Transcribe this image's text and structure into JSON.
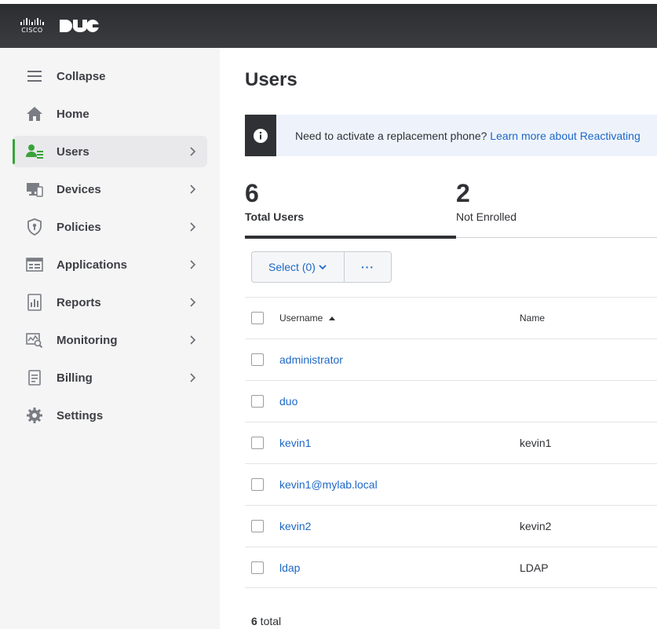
{
  "brand": {
    "cisco": "CISCO",
    "accent": "#39a33a",
    "link": "#1d68c7",
    "topbar": "#2b2d30"
  },
  "sidebar": {
    "items": [
      {
        "label": "Collapse",
        "icon": "menu-icon"
      },
      {
        "label": "Home",
        "icon": "home-icon"
      },
      {
        "label": "Users",
        "icon": "users-icon",
        "active": true
      },
      {
        "label": "Devices",
        "icon": "devices-icon"
      },
      {
        "label": "Policies",
        "icon": "shield-icon"
      },
      {
        "label": "Applications",
        "icon": "applications-icon"
      },
      {
        "label": "Reports",
        "icon": "reports-icon"
      },
      {
        "label": "Monitoring",
        "icon": "monitoring-icon"
      },
      {
        "label": "Billing",
        "icon": "billing-icon"
      },
      {
        "label": "Settings",
        "icon": "gear-icon"
      }
    ]
  },
  "main": {
    "title": "Users",
    "banner": {
      "text": "Need to activate a replacement phone? ",
      "link": "Learn more about Reactivating"
    },
    "stats": [
      {
        "value": "6",
        "label": "Total Users"
      },
      {
        "value": "2",
        "label": "Not Enrolled"
      }
    ],
    "toolbar": {
      "select_label": "Select (0)",
      "more_label": "···"
    },
    "table": {
      "columns": {
        "username": "Username",
        "name": "Name"
      },
      "rows": [
        {
          "username": "administrator",
          "name": ""
        },
        {
          "username": "duo",
          "name": ""
        },
        {
          "username": "kevin1",
          "name": "kevin1"
        },
        {
          "username": "kevin1@mylab.local",
          "name": ""
        },
        {
          "username": "kevin2",
          "name": "kevin2"
        },
        {
          "username": "ldap",
          "name": "LDAP"
        }
      ]
    },
    "footer": {
      "count": "6",
      "suffix": " total"
    }
  }
}
